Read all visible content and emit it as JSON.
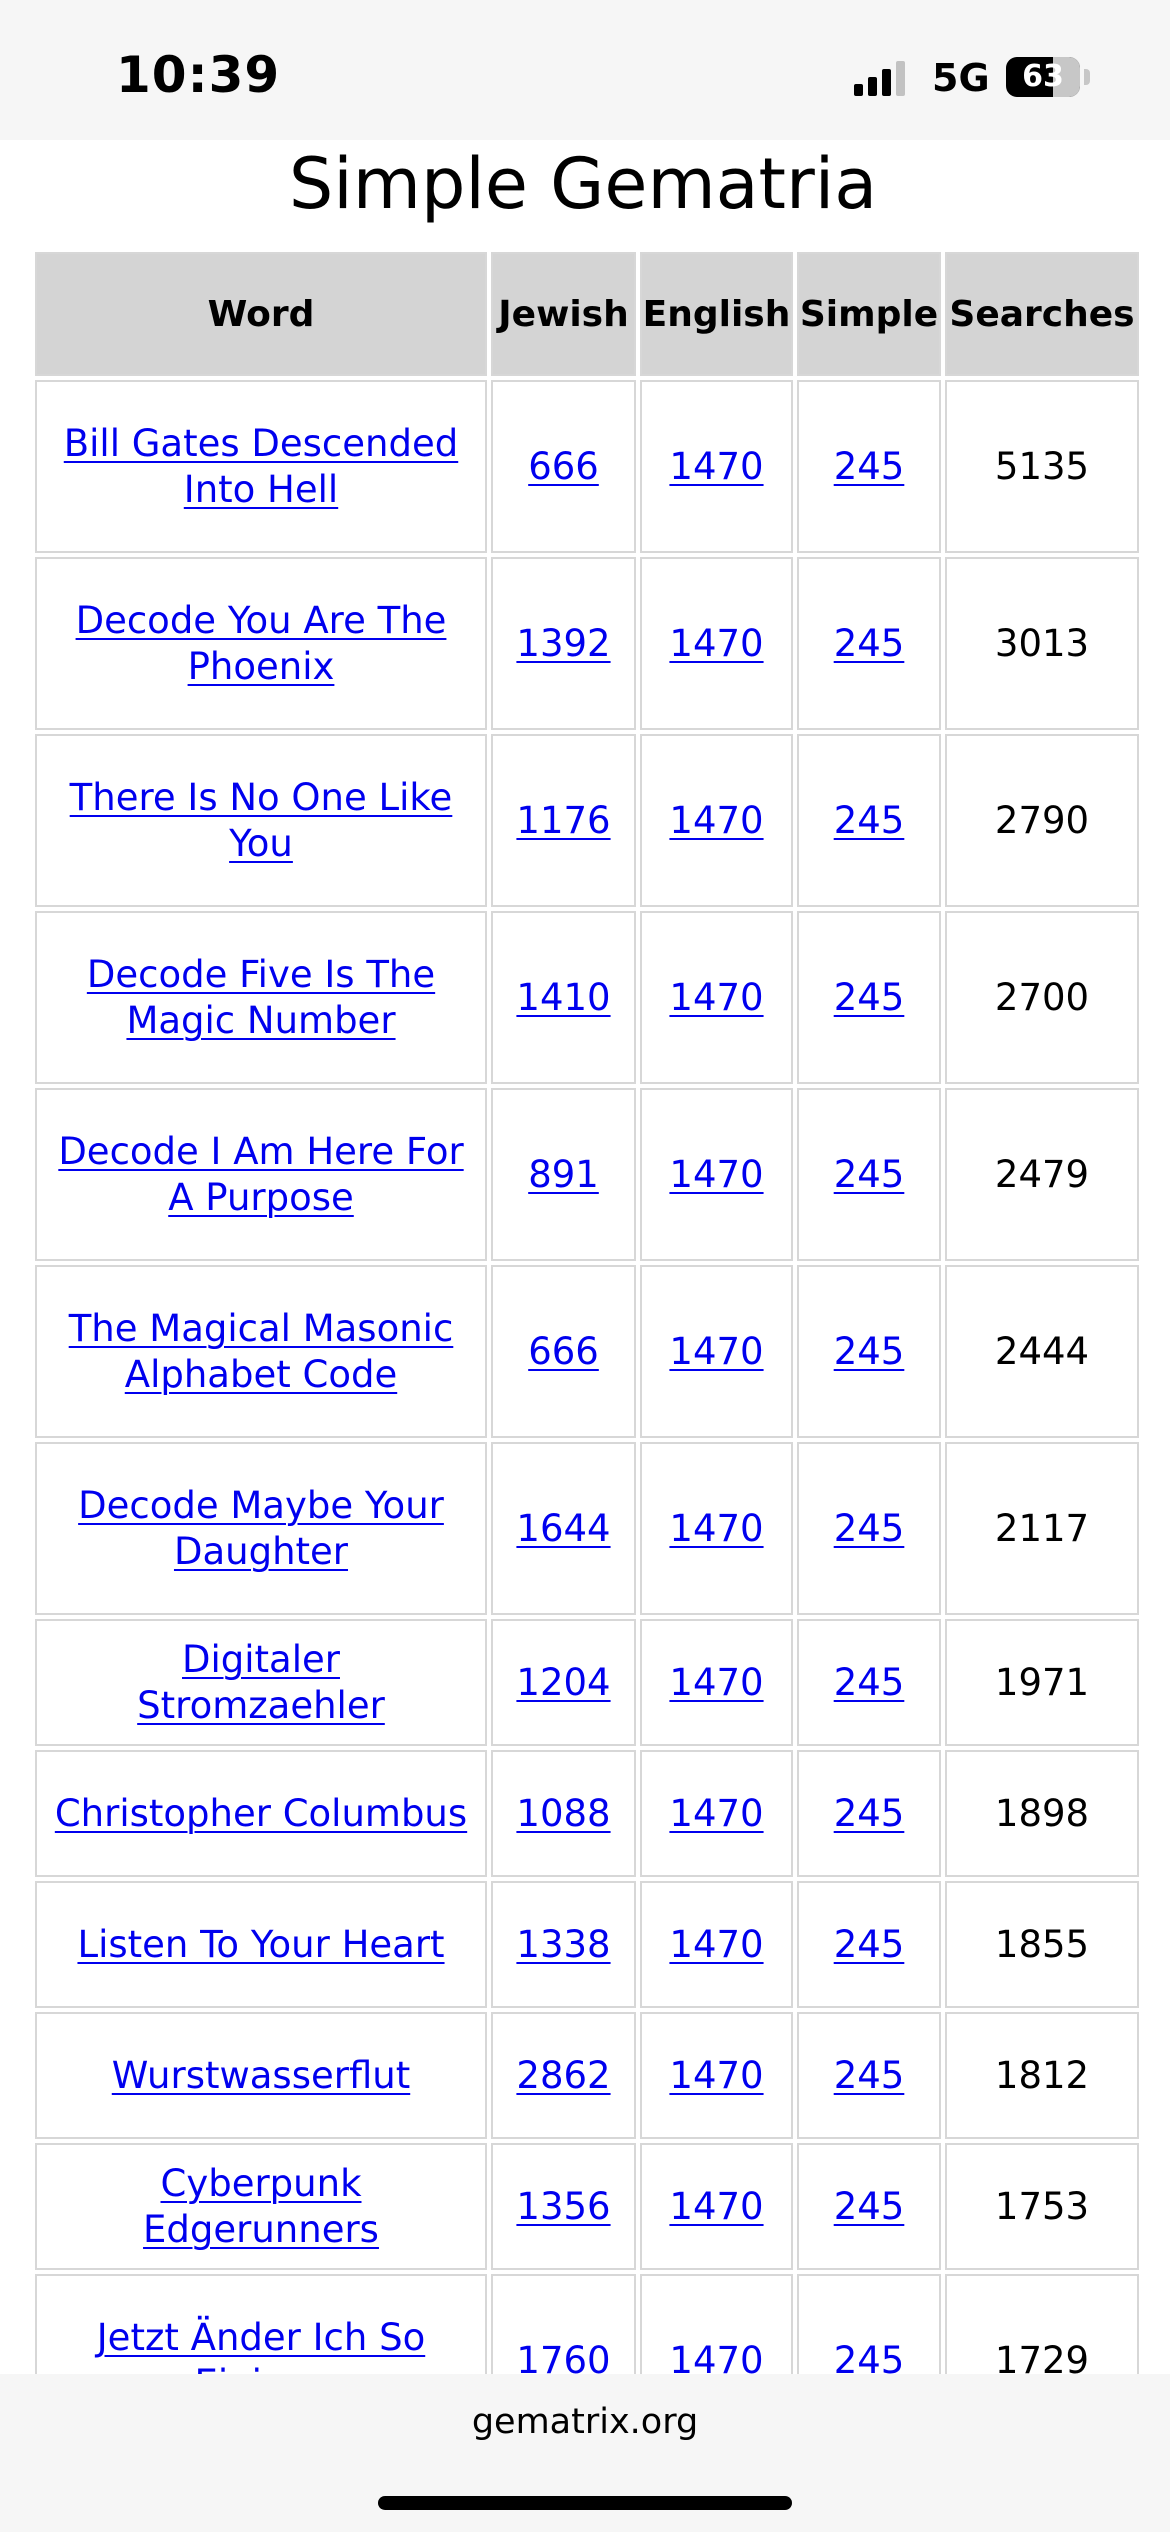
{
  "status_bar": {
    "time": "10:39",
    "network": "5G",
    "battery_level": "63",
    "signal_icon": "cellular-signal-icon"
  },
  "page": {
    "heading": "Simple Gematria"
  },
  "table": {
    "headers": {
      "word": "Word",
      "jewish": "Jewish",
      "english": "English",
      "simple": "Simple",
      "searches": "Searches"
    },
    "rows": [
      {
        "word": "Bill Gates Descended Into Hell",
        "jewish": "666",
        "english": "1470",
        "simple": "245",
        "searches": "5135"
      },
      {
        "word": "Decode You Are The Phoenix",
        "jewish": "1392",
        "english": "1470",
        "simple": "245",
        "searches": "3013"
      },
      {
        "word": "There Is No One Like You",
        "jewish": "1176",
        "english": "1470",
        "simple": "245",
        "searches": "2790"
      },
      {
        "word": "Decode Five Is The Magic Number",
        "jewish": "1410",
        "english": "1470",
        "simple": "245",
        "searches": "2700"
      },
      {
        "word": "Decode I Am Here For A Purpose",
        "jewish": "891",
        "english": "1470",
        "simple": "245",
        "searches": "2479"
      },
      {
        "word": "The Magical Masonic Alphabet Code",
        "jewish": "666",
        "english": "1470",
        "simple": "245",
        "searches": "2444"
      },
      {
        "word": "Decode Maybe Your Daughter",
        "jewish": "1644",
        "english": "1470",
        "simple": "245",
        "searches": "2117"
      },
      {
        "word": "Digitaler Stromzaehler",
        "jewish": "1204",
        "english": "1470",
        "simple": "245",
        "searches": "1971"
      },
      {
        "word": "Christopher Columbus",
        "jewish": "1088",
        "english": "1470",
        "simple": "245",
        "searches": "1898"
      },
      {
        "word": "Listen To Your Heart",
        "jewish": "1338",
        "english": "1470",
        "simple": "245",
        "searches": "1855"
      },
      {
        "word": "Wurstwasserflut",
        "jewish": "2862",
        "english": "1470",
        "simple": "245",
        "searches": "1812"
      },
      {
        "word": "Cyberpunk Edgerunners",
        "jewish": "1356",
        "english": "1470",
        "simple": "245",
        "searches": "1753"
      },
      {
        "word": "Jetzt Änder Ich So Einiges",
        "jewish": "1760",
        "english": "1470",
        "simple": "245",
        "searches": "1729"
      }
    ]
  },
  "browser": {
    "url": "gematrix.org"
  },
  "colors": {
    "link": "#0000ee",
    "header_bg": "#d4d4d4",
    "border": "#d7d7d7",
    "bar_bg": "#f6f6f6"
  }
}
